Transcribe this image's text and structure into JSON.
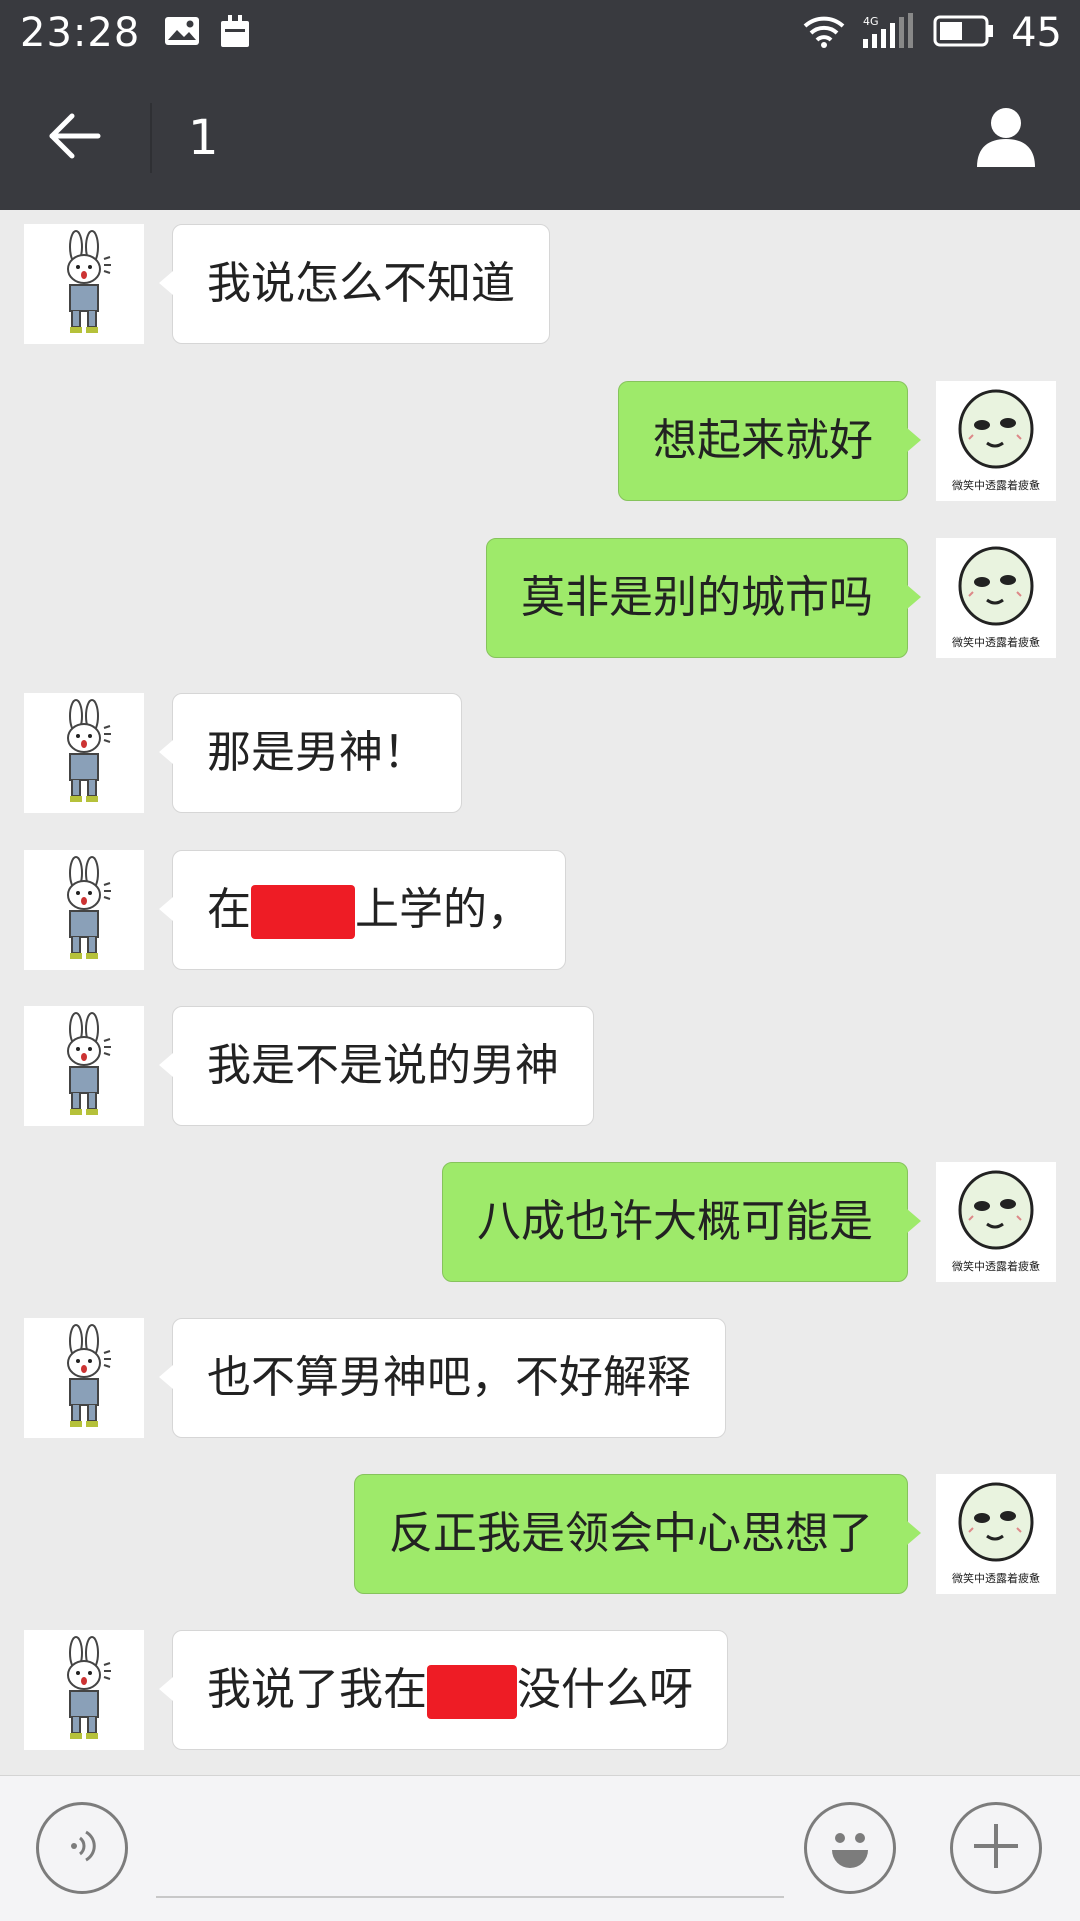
{
  "status_bar": {
    "time": "23:28",
    "network": "4G",
    "battery_percent": "45",
    "icons": [
      "image-notification-icon",
      "calendar-notification-icon",
      "wifi-icon",
      "signal-icon",
      "battery-icon"
    ]
  },
  "header": {
    "title": "1",
    "back_icon": "back-arrow-icon",
    "profile_icon": "person-icon"
  },
  "avatars": {
    "friend": "bunny-avatar",
    "me": "meme-face-avatar",
    "me_caption": "微笑中透露着疲惫"
  },
  "messages": [
    {
      "side": "left",
      "text": "我说怎么不知道"
    },
    {
      "side": "right",
      "text": "想起来就好"
    },
    {
      "side": "right",
      "text": "莫非是别的城市吗"
    },
    {
      "side": "left",
      "text": "那是男神！"
    },
    {
      "side": "left",
      "text_before": "在",
      "text_after": "上学的，",
      "redacted": true
    },
    {
      "side": "left",
      "text": "我是不是说的男神"
    },
    {
      "side": "right",
      "text": "八成也许大概可能是"
    },
    {
      "side": "left",
      "text": "也不算男神吧，不好解释"
    },
    {
      "side": "right",
      "text": "反正我是领会中心思想了"
    },
    {
      "side": "left",
      "text_before": "我说了我在",
      "text_after": "没什么呀",
      "redacted": true
    }
  ],
  "input_bar": {
    "value": "",
    "voice_icon": "voice-icon",
    "emoji_icon": "emoji-icon",
    "more_icon": "plus-icon"
  },
  "colors": {
    "header_bg": "#393a3f",
    "chat_bg": "#ebebeb",
    "my_bubble": "#9eea6a",
    "their_bubble": "#ffffff",
    "redaction": "#ee1c25"
  }
}
